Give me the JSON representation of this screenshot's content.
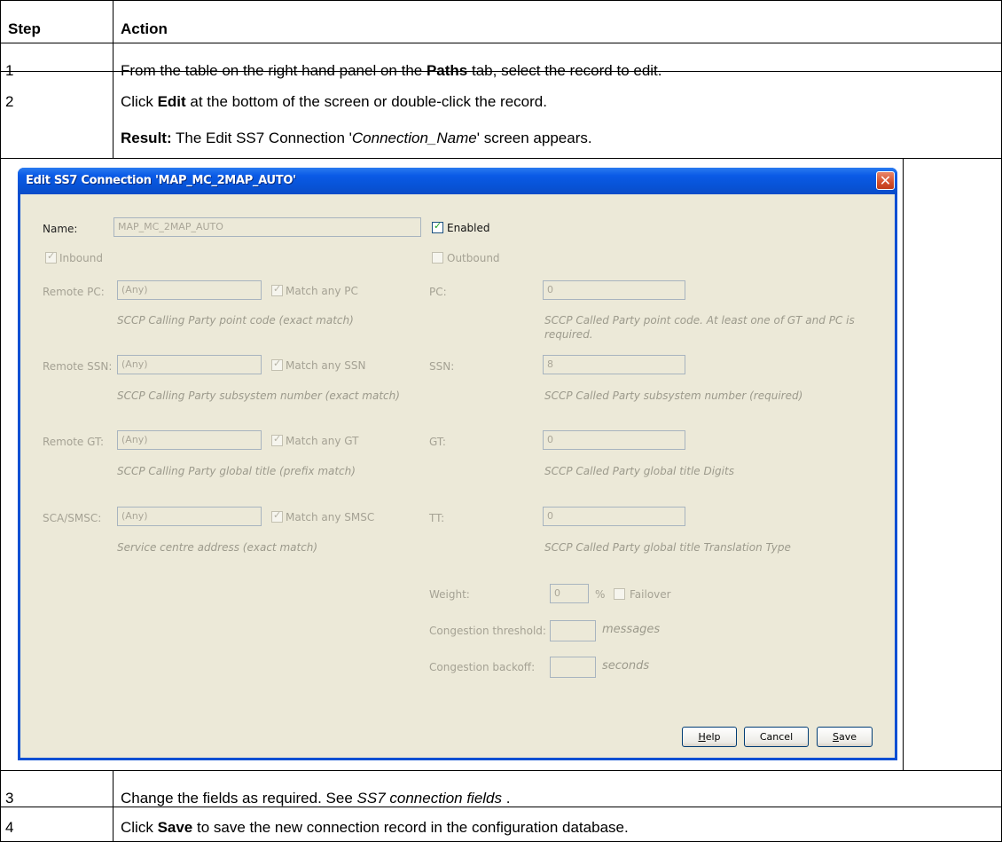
{
  "table": {
    "headers": {
      "step": "Step",
      "action": "Action"
    },
    "rows": [
      {
        "step": "1",
        "pre": "From the table on the right hand panel on the ",
        "bold": "Paths",
        "post": " tab, select the record to edit."
      },
      {
        "step": "2",
        "pre": "Click ",
        "bold": "Edit",
        "post": " at the bottom of the screen or double-click the record.",
        "result_label": "Result:",
        "result_pre": " The Edit SS7 Connection '",
        "result_italic": "Connection_Name",
        "result_post": "' screen appears."
      },
      {
        "step": "3",
        "pre": "Change the fields as required. See ",
        "italic": "SS7 connection fields",
        "post": " ."
      },
      {
        "step": "4",
        "pre": "Click ",
        "bold": "Save",
        "post": " to save the new connection record in the configuration database."
      }
    ]
  },
  "dialog": {
    "title": "Edit SS7 Connection 'MAP_MC_2MAP_AUTO'",
    "close_glyph": "✕",
    "name_label": "Name:",
    "name_value": "MAP_MC_2MAP_AUTO",
    "enabled_label": "Enabled",
    "enabled_checked": true,
    "inbound_label": "Inbound",
    "inbound_checked": true,
    "outbound_label": "Outbound",
    "outbound_checked": false,
    "remote_pc": {
      "label": "Remote PC:",
      "value": "(Any)",
      "match_label": "Match any PC",
      "hint": "SCCP Calling Party point code (exact match)"
    },
    "pc": {
      "label": "PC:",
      "value": "0",
      "hint": "SCCP Called Party point code. At least one of GT and PC is required."
    },
    "remote_ssn": {
      "label": "Remote SSN:",
      "value": "(Any)",
      "match_label": "Match any SSN",
      "hint": "SCCP Calling Party subsystem number (exact match)"
    },
    "ssn": {
      "label": "SSN:",
      "value": "8",
      "hint": "SCCP Called Party subsystem number (required)"
    },
    "remote_gt": {
      "label": "Remote GT:",
      "value": "(Any)",
      "match_label": "Match any GT",
      "hint": "SCCP Calling Party global title (prefix match)"
    },
    "gt": {
      "label": "GT:",
      "value": "0",
      "hint": "SCCP Called Party global title Digits"
    },
    "sca": {
      "label": "SCA/SMSC:",
      "value": "(Any)",
      "match_label": "Match any SMSC",
      "hint": "Service centre address (exact match)"
    },
    "tt": {
      "label": "TT:",
      "value": "0",
      "hint": "SCCP Called Party global title Translation Type"
    },
    "weight": {
      "label": "Weight:",
      "value": "0",
      "unit": "%",
      "failover_label": "Failover"
    },
    "congestion_threshold": {
      "label": "Congestion threshold:",
      "value": "",
      "unit": "messages"
    },
    "congestion_backoff": {
      "label": "Congestion backoff:",
      "value": "",
      "unit": "seconds"
    },
    "buttons": {
      "help_mnemonic": "H",
      "help_rest": "elp",
      "cancel": "Cancel",
      "save_mnemonic": "S",
      "save_rest": "ave"
    }
  }
}
